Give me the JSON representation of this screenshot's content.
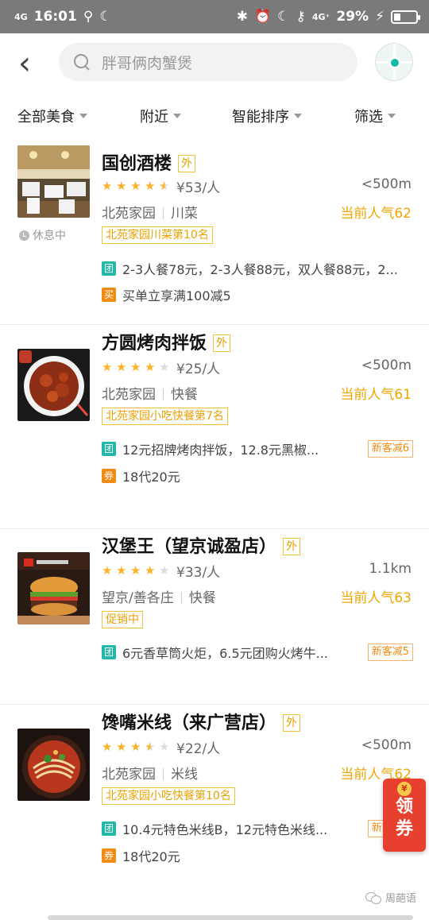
{
  "status_bar": {
    "signal": "4G",
    "time": "16:01",
    "network": "4G⁺",
    "battery": "29%",
    "battery_level": 0.29
  },
  "header": {
    "back_icon": "chevron-left-icon",
    "search_placeholder": "胖哥俩肉蟹煲",
    "map_icon": "map-location-icon"
  },
  "filters": [
    {
      "label": "全部美食"
    },
    {
      "label": "附近"
    },
    {
      "label": "智能排序"
    },
    {
      "label": "筛选"
    }
  ],
  "restaurants": [
    {
      "name": "国创酒楼",
      "delivery_tag": "外",
      "rating": 4.5,
      "price": "¥53/人",
      "distance": "<500m",
      "area": "北苑家园",
      "cuisine": "川菜",
      "popularity": "当前人气62",
      "rank": "北苑家园川菜第10名",
      "status": "休息中",
      "deals": [
        {
          "type": "团",
          "text": "2-3人餐78元，2-3人餐88元，双人餐88元，2..."
        },
        {
          "type": "买",
          "text": "买单立享满100减5"
        }
      ]
    },
    {
      "name": "方圆烤肉拌饭",
      "delivery_tag": "外",
      "rating": 4,
      "price": "¥25/人",
      "distance": "<500m",
      "area": "北苑家园",
      "cuisine": "快餐",
      "popularity": "当前人气61",
      "rank": "北苑家园小吃快餐第7名",
      "deals": [
        {
          "type": "团",
          "text": "12元招牌烤肉拌饭，12.8元黑椒...",
          "badge": "新客减6"
        },
        {
          "type": "券",
          "text": "18代20元"
        }
      ]
    },
    {
      "name": "汉堡王（望京诚盈店）",
      "delivery_tag": "外",
      "rating": 4,
      "price": "¥33/人",
      "distance": "1.1km",
      "area": "望京/善各庄",
      "cuisine": "快餐",
      "popularity": "当前人气63",
      "rank": "促销中",
      "deals": [
        {
          "type": "团",
          "text": "6元香草筒火炬，6.5元团购火烤牛...",
          "badge": "新客减5"
        }
      ]
    },
    {
      "name": "馋嘴米线（来广营店）",
      "delivery_tag": "外",
      "rating": 3.5,
      "price": "¥22/人",
      "distance": "<500m",
      "area": "北苑家园",
      "cuisine": "米线",
      "popularity": "当前人气62",
      "rank": "北苑家园小吃快餐第10名",
      "deals": [
        {
          "type": "团",
          "text": "10.4元特色米线B，12元特色米线...",
          "badge": "新客减6"
        },
        {
          "type": "券",
          "text": "18代20元"
        }
      ]
    }
  ],
  "coupon_float": {
    "label_1": "领",
    "label_2": "券",
    "coin": "¥"
  },
  "watermark": "周葩语"
}
